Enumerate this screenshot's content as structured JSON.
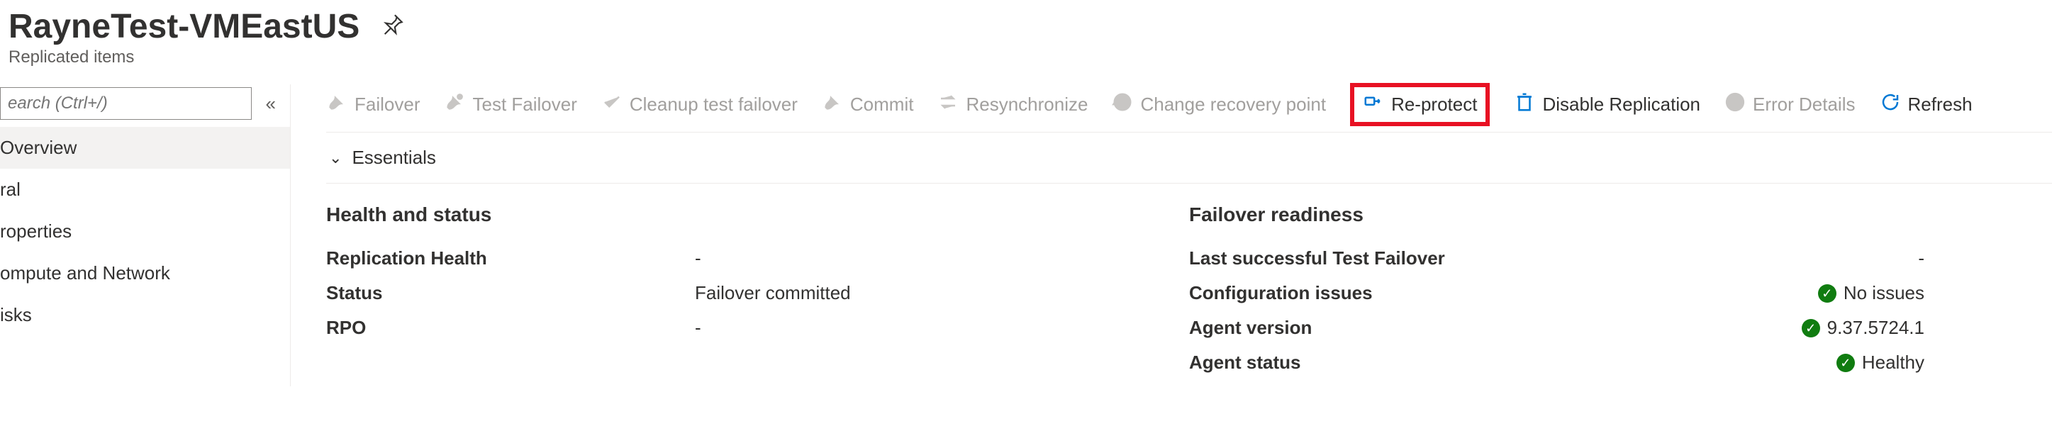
{
  "header": {
    "title": "RayneTest-VMEastUS",
    "subtitle": "Replicated items"
  },
  "sidebar": {
    "search_placeholder": "earch (Ctrl+/)",
    "items": [
      {
        "label": "Overview",
        "active": true
      },
      {
        "label": "ral"
      },
      {
        "label": "roperties"
      },
      {
        "label": "ompute and Network"
      },
      {
        "label": "isks"
      }
    ]
  },
  "toolbar": {
    "items": [
      {
        "label": "Failover",
        "icon": "failover-icon",
        "state": "disabled"
      },
      {
        "label": "Test Failover",
        "icon": "test-failover-icon",
        "state": "disabled"
      },
      {
        "label": "Cleanup test failover",
        "icon": "cleanup-icon",
        "state": "disabled"
      },
      {
        "label": "Commit",
        "icon": "commit-icon",
        "state": "disabled"
      },
      {
        "label": "Resynchronize",
        "icon": "resync-icon",
        "state": "disabled"
      },
      {
        "label": "Change recovery point",
        "icon": "recovery-point-icon",
        "state": "disabled"
      },
      {
        "label": "Re-protect",
        "icon": "reprotect-icon",
        "state": "highlight"
      },
      {
        "label": "Disable Replication",
        "icon": "disable-replication-icon",
        "state": "enabled"
      },
      {
        "label": "Error Details",
        "icon": "error-details-icon",
        "state": "disabled"
      },
      {
        "label": "Refresh",
        "icon": "refresh-icon",
        "state": "enabled"
      }
    ]
  },
  "essentials_label": "Essentials",
  "health": {
    "title": "Health and status",
    "rows": [
      {
        "key": "Replication Health",
        "value": "-"
      },
      {
        "key": "Status",
        "value": "Failover committed"
      },
      {
        "key": "RPO",
        "value": "-"
      }
    ]
  },
  "readiness": {
    "title": "Failover readiness",
    "rows": [
      {
        "key": "Last successful Test Failover",
        "value": "-",
        "ok": false
      },
      {
        "key": "Configuration issues",
        "value": "No issues",
        "ok": true
      },
      {
        "key": "Agent version",
        "value": "9.37.5724.1",
        "ok": true
      },
      {
        "key": "Agent status",
        "value": "Healthy",
        "ok": true
      }
    ]
  }
}
